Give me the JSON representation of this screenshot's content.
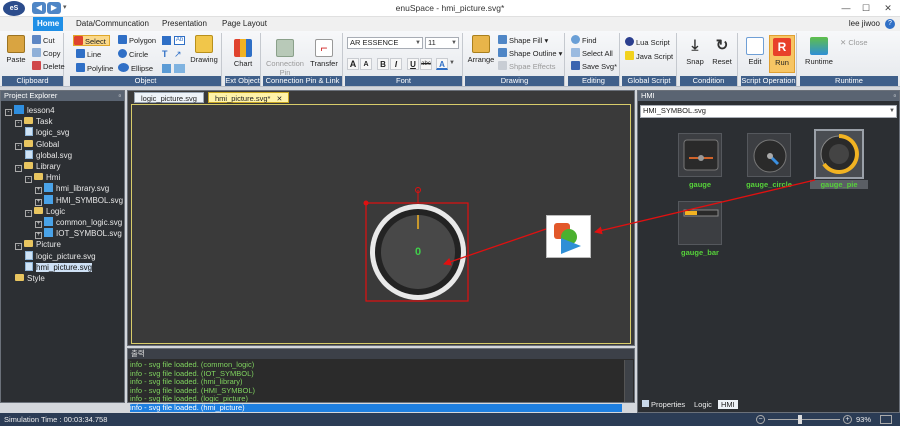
{
  "window": {
    "title": "enuSpace - hmi_picture.svg*",
    "logo": "eS",
    "controls": {
      "minimize": "—",
      "maximize": "☐",
      "close": "✕"
    }
  },
  "tabs": [
    "Home",
    "Data/Communcation",
    "Presentation",
    "Page Layout"
  ],
  "user": "lee jiwoo",
  "help": "?",
  "ribbon": {
    "clipboard": {
      "label": "Clipboard",
      "paste": "Paste",
      "cut": "Cut",
      "copy": "Copy",
      "delete": "Delete"
    },
    "object": {
      "label": "Object",
      "select": "Select",
      "line": "Line",
      "polyline": "Polyline",
      "polygon": "Polygon",
      "circle": "Circle",
      "ellipse": "Ellipse",
      "drawing": "Drawing"
    },
    "ext_object": {
      "label": "Ext Object",
      "chart": "Chart"
    },
    "connection": {
      "label": "Connection Pin & Link",
      "pin": "Connection Pin",
      "transfer": "Transfer"
    },
    "font": {
      "label": "Font",
      "family": "AR ESSENCE",
      "size": "11",
      "bold": "B",
      "italic": "I",
      "underline": "U",
      "strike": "abc",
      "color": "A",
      "grow": "A",
      "shrink": "A"
    },
    "drawing": {
      "label": "Drawing",
      "arrange": "Arrange",
      "fill": "Shape Fill",
      "outline": "Shape Outline",
      "effects": "Shpae Effects"
    },
    "editing": {
      "label": "Editing",
      "find": "Find",
      "select_all": "Select All",
      "save": "Save Svg*"
    },
    "global_script": {
      "label": "Global Script",
      "lua": "Lua Script",
      "java": "Java Script"
    },
    "condition": {
      "label": "Condition",
      "snap": "Snap",
      "reset": "Reset"
    },
    "script_operation": {
      "label": "Script Operation",
      "edit": "Edit",
      "run": "Run"
    },
    "runtime": {
      "label": "Runtime",
      "runtime": "Runtime",
      "close": "Close"
    }
  },
  "explorer": {
    "title": "Project Explorer",
    "pin": "⌂",
    "items": [
      {
        "label": "lesson4",
        "kind": "project",
        "expand": "-"
      },
      {
        "label": "Task",
        "kind": "folder",
        "expand": "-"
      },
      {
        "label": "logic_svg",
        "kind": "file",
        "expand": ""
      },
      {
        "label": "Global",
        "kind": "folder",
        "expand": "-"
      },
      {
        "label": "global.svg",
        "kind": "file",
        "expand": ""
      },
      {
        "label": "Library",
        "kind": "folder",
        "expand": "-"
      },
      {
        "label": "Hmi",
        "kind": "folder",
        "expand": "-"
      },
      {
        "label": "hmi_library.svg",
        "kind": "symbol",
        "expand": "+"
      },
      {
        "label": "HMI_SYMBOL.svg",
        "kind": "symbol",
        "expand": "+"
      },
      {
        "label": "Logic",
        "kind": "folder",
        "expand": "-"
      },
      {
        "label": "common_logic.svg",
        "kind": "symbol",
        "expand": "+"
      },
      {
        "label": "IOT_SYMBOL.svg",
        "kind": "symbol",
        "expand": "+"
      },
      {
        "label": "Picture",
        "kind": "folder",
        "expand": "-"
      },
      {
        "label": "logic_picture.svg",
        "kind": "file",
        "expand": ""
      },
      {
        "label": "hmi_picture.svg",
        "kind": "file",
        "expand": ""
      },
      {
        "label": "Style",
        "kind": "folder",
        "expand": ""
      }
    ],
    "selected": "hmi_picture.svg"
  },
  "documents": {
    "tabs": [
      "logic_picture.svg",
      "hmi_picture.svg*"
    ],
    "active": "hmi_picture.svg*",
    "close": "✕"
  },
  "canvas": {
    "gauge_value": "0"
  },
  "output": {
    "title": "출력",
    "lines": [
      "info - svg file loaded. (common_logic)",
      "info - svg file loaded. (IOT_SYMBOL)",
      "info - svg file loaded. (hmi_library)",
      "info - svg file loaded. (HMI_SYMBOL)",
      "info - svg file loaded. (logic_picture)",
      "info - svg file loaded. (hmi_picture)"
    ]
  },
  "hmi": {
    "title": "HMI",
    "library": "HMI_SYMBOL.svg",
    "symbols": [
      "gauge",
      "gauge_circle",
      "gauge_pie",
      "gauge_bar"
    ],
    "bottom_tabs": [
      "Properties",
      "Logic",
      "HMI"
    ]
  },
  "status": {
    "sim_time": "Simulation Time : 00:03:34.758",
    "zoom": "93%"
  },
  "colors": {
    "accent": "#1f8fe6",
    "gauge_value": "#3fd04a",
    "selection": "#e01010",
    "pie": "#f2b322"
  }
}
